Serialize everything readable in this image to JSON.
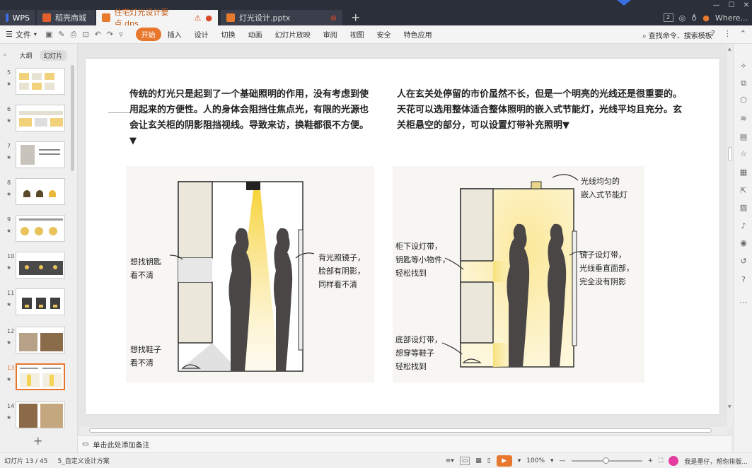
{
  "tabs": {
    "wps": "WPS",
    "store": "稻壳商城",
    "active_doc": "住宅灯光设计要点.dps",
    "second_doc": "灯光设计.pptx",
    "add": "+",
    "count_badge": "2",
    "right_text": "Where..."
  },
  "menu": {
    "file": "文件",
    "items": [
      "开始",
      "插入",
      "设计",
      "切换",
      "动画",
      "幻灯片放映",
      "审阅",
      "视图",
      "安全",
      "特色应用"
    ],
    "search": "查找命令、搜索模板",
    "help": "?"
  },
  "pane": {
    "outline_tab": "大纲",
    "slides_tab": "幻灯片",
    "thumbs": [
      {
        "num": "5"
      },
      {
        "num": "6"
      },
      {
        "num": "7"
      },
      {
        "num": "8"
      },
      {
        "num": "9"
      },
      {
        "num": "10"
      },
      {
        "num": "11"
      },
      {
        "num": "12"
      },
      {
        "num": "13"
      },
      {
        "num": "14"
      }
    ],
    "star": "★",
    "add": "+"
  },
  "slide": {
    "left_text": "传统的灯光只是起到了一个基础照明的作用，没有考虑到使用起来的方便性。人的身体会阻挡住焦点光，有限的光源也会让玄关柜的阴影阻挡视线。导致来访，换鞋都很不方便。▼",
    "right_text": "人在玄关处停留的市价虽然不长，但是一个明亮的光线还是很重要的。天花可以选用整体适合整体照明的嵌入式节能灯，光线平均且充分。玄关柜悬空的部分，可以设置灯带补充照明▼",
    "left_illu": {
      "label_key": "想找钥匙\n看不清",
      "label_shoe": "想找鞋子\n看不清",
      "label_back": "背光照镜子，\n脸部有阴影，\n同样看不清"
    },
    "right_illu": {
      "label_lamp": "光线均匀的\n嵌入式节能灯",
      "label_cabinet": "柜下设灯带，\n钥匙等小物件，\n轻松找到",
      "label_mirror": "镜子设灯带，\n光线垂直面部，\n完全没有阴影",
      "label_bottom": "底部设灯带，\n想穿等鞋子\n轻松找到"
    }
  },
  "notes": {
    "placeholder": "单击此处添加备注"
  },
  "status": {
    "slide_count": "幻灯片 13 / 45",
    "template": "5_自定义设计方案",
    "zoom": "100%",
    "assistant": "我是墨仔，帮你排版..."
  },
  "colors": {
    "accent": "#e8772e",
    "tabbar": "#2a2f3a",
    "light": "#f6d86a"
  }
}
